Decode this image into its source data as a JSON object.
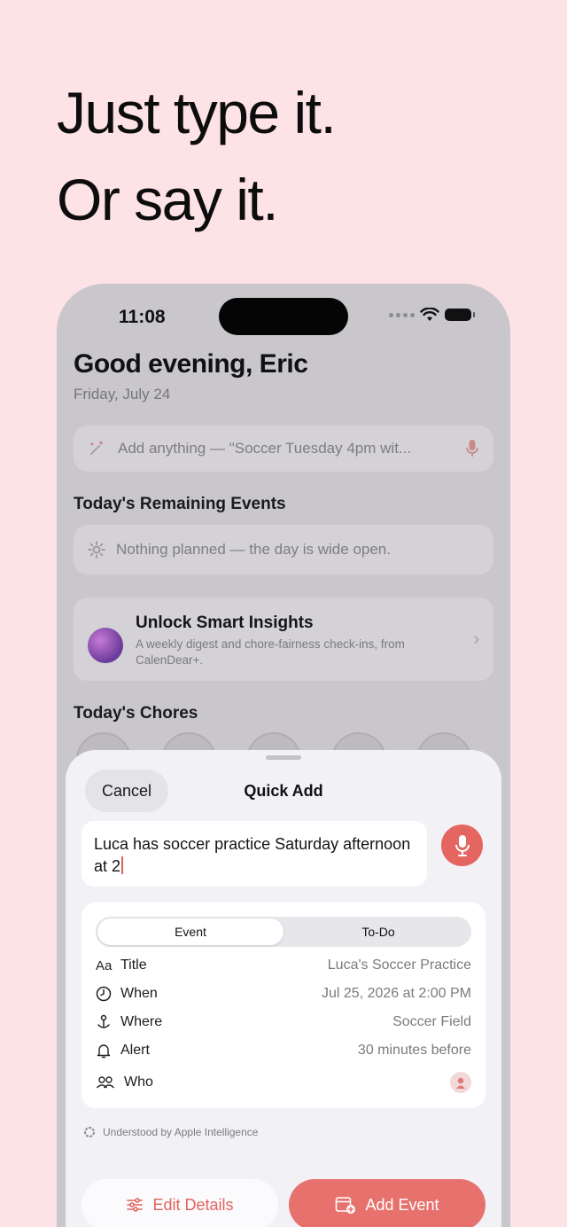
{
  "headline": {
    "line1": "Just type it.",
    "line2": "Or say it."
  },
  "status": {
    "time": "11:08"
  },
  "home": {
    "greeting": "Good evening, Eric",
    "date": "Friday, July 24",
    "search_placeholder": "Add anything — \"Soccer Tuesday 4pm wit...",
    "remaining_title": "Today's Remaining Events",
    "empty_text": "Nothing planned — the day is wide open.",
    "insights_title": "Unlock Smart Insights",
    "insights_sub": "A weekly digest and chore-fairness check-ins, from CalenDear+.",
    "chores_title": "Today's Chores"
  },
  "sheet": {
    "cancel_label": "Cancel",
    "title": "Quick Add",
    "input_text": "Luca has soccer practice Saturday afternoon at 2",
    "tabs": [
      {
        "label": "Event",
        "active": true
      },
      {
        "label": "To-Do",
        "active": false
      }
    ],
    "fields": [
      {
        "icon": "Aa",
        "label": "Title",
        "value": "Luca's Soccer Practice"
      },
      {
        "icon": "clock-icon",
        "label": "When",
        "value": "Jul 25, 2026 at 2:00 PM"
      },
      {
        "icon": "location-pin-icon",
        "label": "Where",
        "value": "Soccer Field"
      },
      {
        "icon": "bell-icon",
        "label": "Alert",
        "value": "30 minutes before"
      },
      {
        "icon": "people-icon",
        "label": "Who",
        "value": ""
      }
    ],
    "understood": "Understood by Apple Intelligence",
    "edit_label": "Edit Details",
    "add_label": "Add Event"
  },
  "colors": {
    "background": "#fde2e6",
    "accent": "#e7716d"
  }
}
